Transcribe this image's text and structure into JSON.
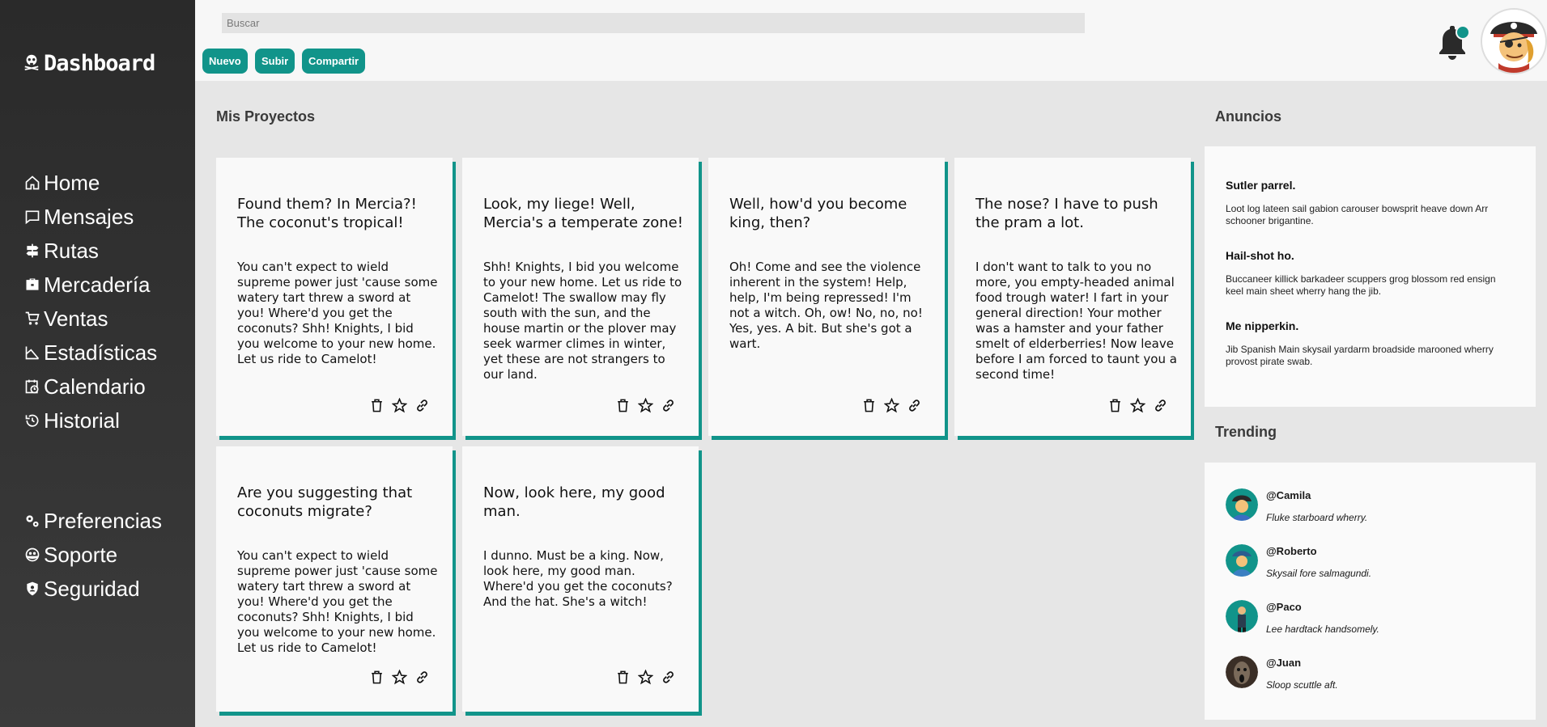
{
  "sidebar": {
    "brand": "Dashboard",
    "items": [
      {
        "label": "Home",
        "icon": "home-icon"
      },
      {
        "label": "Mensajes",
        "icon": "message-icon"
      },
      {
        "label": "Rutas",
        "icon": "signpost-icon"
      },
      {
        "label": "Mercadería",
        "icon": "toolbox-icon"
      },
      {
        "label": "Ventas",
        "icon": "cart-icon"
      },
      {
        "label": "Estadísticas",
        "icon": "chart-icon"
      },
      {
        "label": "Calendario",
        "icon": "calendar-clock-icon"
      },
      {
        "label": "Historial",
        "icon": "history-icon"
      }
    ],
    "items2": [
      {
        "label": "Preferencias",
        "icon": "gears-icon"
      },
      {
        "label": "Soporte",
        "icon": "support-icon"
      },
      {
        "label": "Seguridad",
        "icon": "shield-icon"
      }
    ]
  },
  "header": {
    "search_placeholder": "Buscar",
    "buttons": [
      "Nuevo",
      "Subir",
      "Compartir"
    ]
  },
  "projects": {
    "title": "Mis Proyectos",
    "cards": [
      {
        "title": "Found them? In Mercia?! The coconut's tropical!",
        "body": "You can't expect to wield supreme power just 'cause some watery tart threw a sword at you! Where'd you get the coconuts? Shh! Knights, I bid you welcome to your new home. Let us ride to Camelot!"
      },
      {
        "title": "Look, my liege! Well, Mercia's a temperate zone!",
        "body": "Shh! Knights, I bid you welcome to your new home. Let us ride to Camelot! The swallow may fly south with the sun, and the house martin or the plover may seek warmer climes in winter, yet these are not strangers to our land."
      },
      {
        "title": "Well, how'd you become king, then?",
        "body": "Oh! Come and see the violence inherent in the system! Help, help, I'm being repressed! I'm not a witch. Oh, ow! No, no, no! Yes, yes. A bit. But she's got a wart."
      },
      {
        "title": "The nose? I have to push the pram a lot.",
        "body": "I don't want to talk to you no more, you empty-headed animal food trough water! I fart in your general direction! Your mother was a hamster and your father smelt of elderberries! Now leave before I am forced to taunt you a second time!"
      },
      {
        "title": "Are you suggesting that coconuts migrate?",
        "body": "You can't expect to wield supreme power just 'cause some watery tart threw a sword at you! Where'd you get the coconuts? Shh! Knights, I bid you welcome to your new home. Let us ride to Camelot!"
      },
      {
        "title": "Now, look here, my good man.",
        "body": "I dunno. Must be a king. Now, look here, my good man. Where'd you get the coconuts? And the hat. She's a witch!"
      }
    ]
  },
  "announcements": {
    "title": "Anuncios",
    "items": [
      {
        "title": "Sutler parrel.",
        "body": "Loot log lateen sail gabion carouser bowsprit heave down Arr schooner brigantine."
      },
      {
        "title": "Hail-shot ho.",
        "body": "Buccaneer killick barkadeer scuppers grog blossom red ensign keel main sheet wherry hang the jib."
      },
      {
        "title": "Me nipperkin.",
        "body": "Jib Spanish Main skysail yardarm broadside marooned wherry provost pirate swab."
      }
    ]
  },
  "trending": {
    "title": "Trending",
    "items": [
      {
        "user": "@Camila",
        "msg": "Fluke starboard wherry."
      },
      {
        "user": "@Roberto",
        "msg": "Skysail fore salmagundi."
      },
      {
        "user": "@Paco",
        "msg": "Lee hardtack handsomely."
      },
      {
        "user": "@Juan",
        "msg": "Sloop scuttle aft."
      }
    ]
  },
  "colors": {
    "accent": "#11948a",
    "sidebar": "#2e2e2e",
    "notification_dot": "#11948a"
  }
}
